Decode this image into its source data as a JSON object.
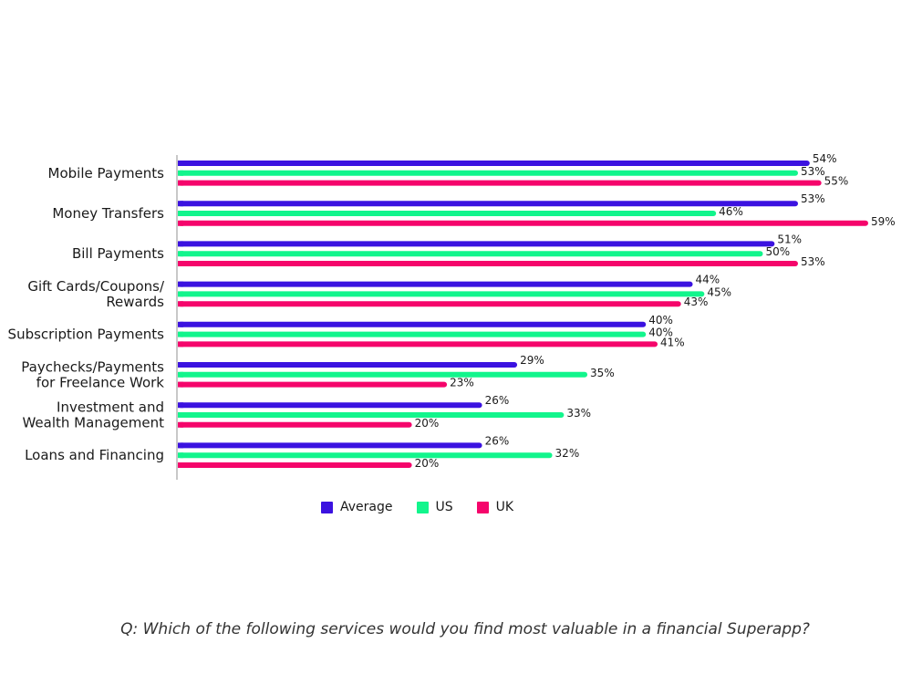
{
  "chart_data": {
    "type": "bar",
    "orientation": "horizontal",
    "title": "",
    "xlabel": "",
    "ylabel": "",
    "xlim": [
      0,
      60
    ],
    "grid": false,
    "legend_position": "bottom-center",
    "value_suffix": "%",
    "categories": [
      [
        "Mobile Payments"
      ],
      [
        "Money Transfers"
      ],
      [
        "Bill Payments"
      ],
      [
        "Gift Cards/Coupons/",
        "Rewards"
      ],
      [
        "Subscription Payments"
      ],
      [
        "Paychecks/Payments",
        "for Freelance Work"
      ],
      [
        "Investment and",
        "Wealth Management"
      ],
      [
        "Loans and Financing"
      ]
    ],
    "series": [
      {
        "name": "Average",
        "color": "#3b12e0",
        "values": [
          54,
          53,
          51,
          44,
          40,
          29,
          26,
          26
        ]
      },
      {
        "name": "US",
        "color": "#12f58c",
        "values": [
          53,
          46,
          50,
          45,
          40,
          35,
          33,
          32
        ]
      },
      {
        "name": "UK",
        "color": "#f5056b",
        "values": [
          55,
          59,
          53,
          43,
          41,
          23,
          20,
          20
        ]
      }
    ]
  },
  "legend": [
    {
      "label": "Average",
      "color": "#3b12e0"
    },
    {
      "label": "US",
      "color": "#12f58c"
    },
    {
      "label": "UK",
      "color": "#f5056b"
    }
  ],
  "question": "Q: Which of the following services would you find most valuable in a financial Superapp?"
}
